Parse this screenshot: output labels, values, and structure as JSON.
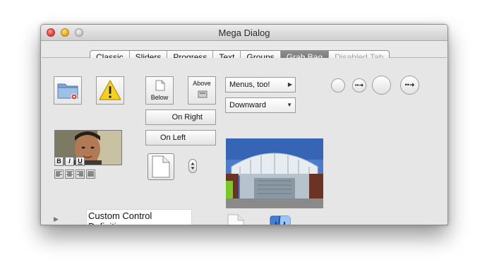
{
  "window": {
    "title": "Mega Dialog"
  },
  "tabs": [
    {
      "label": "Classic",
      "state": "normal"
    },
    {
      "label": "Sliders",
      "state": "normal"
    },
    {
      "label": "Progress",
      "state": "normal"
    },
    {
      "label": "Text",
      "state": "normal"
    },
    {
      "label": "Groups",
      "state": "normal"
    },
    {
      "label": "Grab Bag",
      "state": "selected"
    },
    {
      "label": "Disabled Tab",
      "state": "disabled"
    }
  ],
  "buttons": {
    "below": "Below",
    "above": "Above",
    "on_right": "On Right",
    "on_left": "On Left"
  },
  "popups": {
    "menus": "Menus, too!",
    "downward": "Downward"
  },
  "format": {
    "bold": "B",
    "italic": "I",
    "underline": "U"
  },
  "custom_control": {
    "label": "Custom Control Definition"
  },
  "icons": {
    "folder": "folder-icon",
    "caution": "caution-icon",
    "document": "document-icon",
    "finder": "finder-icon"
  },
  "colors": {
    "selected_tab": "#7a7a7a",
    "disabled_text": "#a3a3a3"
  }
}
